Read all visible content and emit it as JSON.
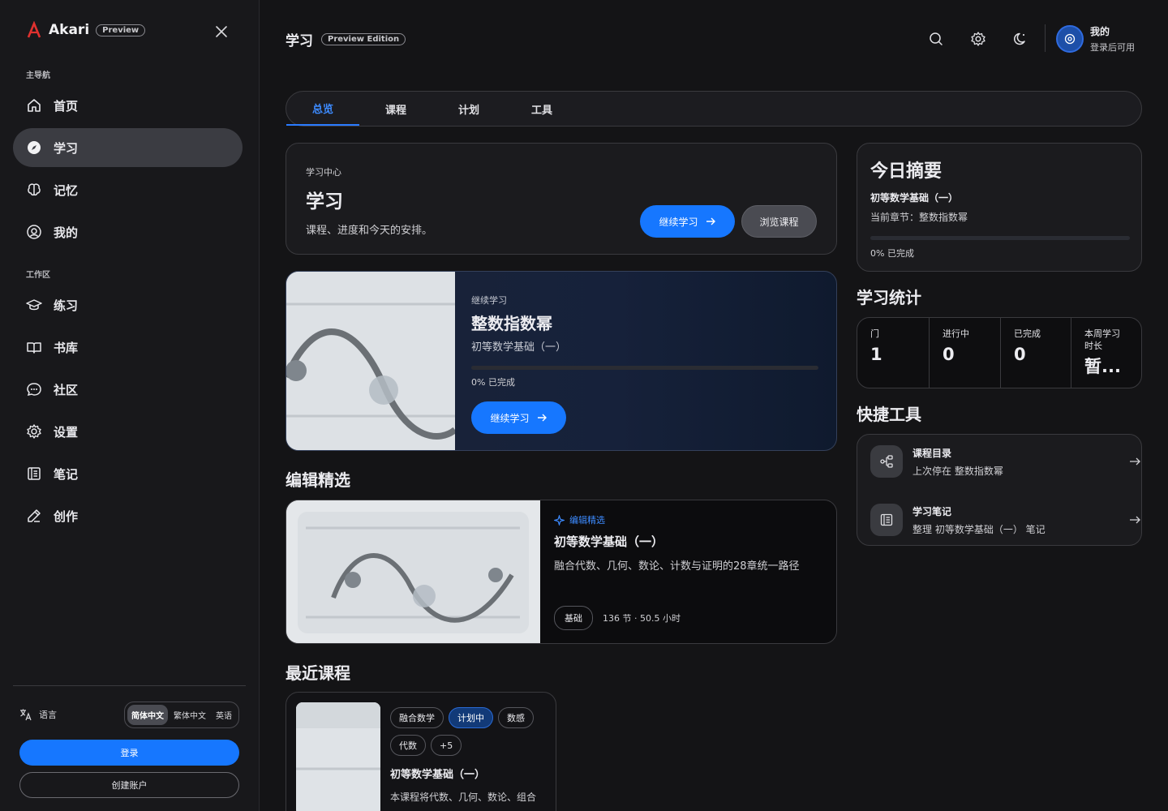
{
  "brand": {
    "name": "Akari",
    "badge": "Preview"
  },
  "sidebar": {
    "main_label": "主导航",
    "main_items": [
      {
        "label": "首页",
        "icon": "home-icon"
      },
      {
        "label": "学习",
        "icon": "compass-icon",
        "active": true
      },
      {
        "label": "记忆",
        "icon": "brain-icon"
      },
      {
        "label": "我的",
        "icon": "user-circle-icon"
      }
    ],
    "work_label": "工作区",
    "work_items": [
      {
        "label": "练习",
        "icon": "graduation-cap-icon"
      },
      {
        "label": "书库",
        "icon": "book-open-icon"
      },
      {
        "label": "社区",
        "icon": "chat-bubble-icon"
      },
      {
        "label": "设置",
        "icon": "gear-icon"
      },
      {
        "label": "笔记",
        "icon": "notebook-icon"
      },
      {
        "label": "创作",
        "icon": "pen-icon"
      }
    ],
    "language": {
      "label": "语言",
      "options": [
        "简体中文",
        "繁体中文",
        "英语"
      ],
      "selected": "简体中文"
    },
    "login_label": "登录",
    "signup_label": "创建账户"
  },
  "header": {
    "title": "学习",
    "badge": "Preview Edition",
    "user_name": "我的",
    "user_sub": "登录后可用"
  },
  "tabs": [
    "总览",
    "课程",
    "计划",
    "工具"
  ],
  "hero": {
    "eyebrow": "学习中心",
    "title": "学习",
    "desc": "课程、进度和今天的安排。",
    "primary": "继续学习",
    "secondary": "浏览课程"
  },
  "continue_card": {
    "eyebrow": "继续学习",
    "title": "整数指数幂",
    "course": "初等数学基础（一）",
    "progress_text": "0% 已完成",
    "progress": 0,
    "button": "继续学习"
  },
  "featured": {
    "section_title": "编辑精选",
    "tag": "编辑精选",
    "title": "初等数学基础（一）",
    "desc": "融合代数、几何、数论、计数与证明的28章统一路径",
    "level": "基础",
    "meta": "136 节 · 50.5 小时"
  },
  "recent": {
    "section_title": "最近课程",
    "chips_row1": [
      "融合数学",
      "计划中",
      "数感"
    ],
    "chips_row2": [
      "代数",
      "+5"
    ],
    "title": "初等数学基础（一）",
    "desc": "本课程将代数、几何、数论、组合"
  },
  "summary": {
    "title": "今日摘要",
    "course": "初等数学基础（一）",
    "chapter": "当前章节：整数指数幂",
    "progress_text": "0% 已完成",
    "progress": 0
  },
  "stats": {
    "title": "学习统计",
    "items": [
      {
        "label": "门",
        "value": "1"
      },
      {
        "label": "进行中",
        "value": "0"
      },
      {
        "label": "已完成",
        "value": "0"
      },
      {
        "label": "本周学习时长",
        "value": "暂..."
      }
    ]
  },
  "tools": {
    "title": "快捷工具",
    "items": [
      {
        "title": "课程目录",
        "sub": "上次停在 整数指数幂",
        "icon": "hierarchy-icon"
      },
      {
        "title": "学习笔记",
        "sub": "整理 初等数学基础（一） 笔记",
        "icon": "notebook-icon"
      }
    ]
  },
  "colors": {
    "accent": "#1677ff",
    "background": "#141416",
    "sidebar": "#18181b",
    "brand_logo": "#e0312f"
  }
}
